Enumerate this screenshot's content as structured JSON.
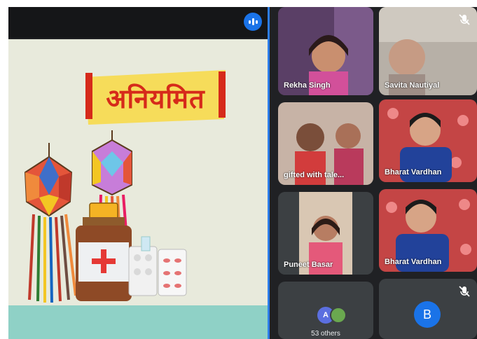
{
  "presentation": {
    "slide_title": "अनियमित"
  },
  "participants": [
    {
      "name": "Rekha Singh",
      "muted": false
    },
    {
      "name": "Savita Nautiyal",
      "muted": true
    },
    {
      "name": "gifted with tale...",
      "muted": false
    },
    {
      "name": "Bharat Vardhan",
      "muted": false
    },
    {
      "name": "Puneet Basar",
      "muted": false
    },
    {
      "name": "Bharat Vardhan",
      "muted": false
    }
  ],
  "others_tile": {
    "avatar_letter": "A",
    "label": "53 others"
  },
  "self_tile": {
    "avatar_letter": "B",
    "muted": true
  },
  "colors": {
    "accent": "#1a73e8",
    "slide_bg": "#e8eadc",
    "title_red": "#d62a1a",
    "banner_yellow": "#f6dc5a"
  }
}
